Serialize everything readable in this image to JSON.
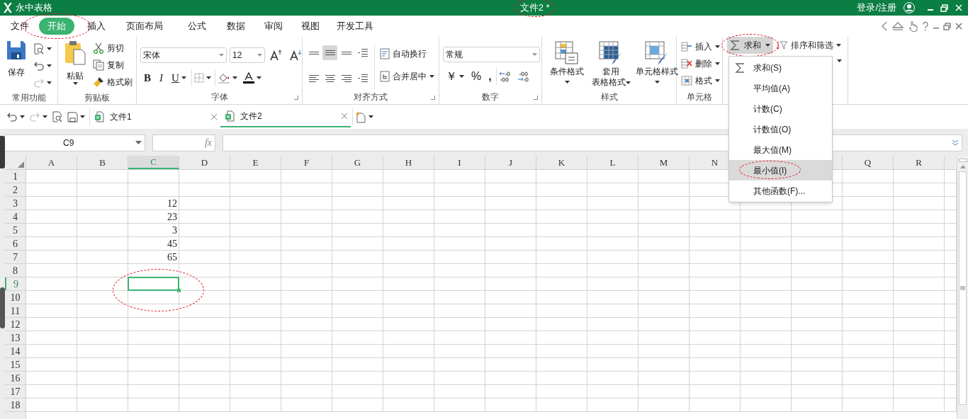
{
  "title_bar": {
    "app_name": "永中表格",
    "document_title": "文件2 *",
    "document_title_circled": true,
    "account": "登录/注册"
  },
  "menu_tabs": [
    {
      "label": "文件",
      "selected": false,
      "circled": false
    },
    {
      "label": "开始",
      "selected": true,
      "circled": true
    },
    {
      "label": "插入",
      "selected": false,
      "circled": false
    },
    {
      "label": "页面布局",
      "selected": false,
      "circled": false
    },
    {
      "label": "公式",
      "selected": false,
      "circled": false
    },
    {
      "label": "数据",
      "selected": false,
      "circled": false
    },
    {
      "label": "审阅",
      "selected": false,
      "circled": false
    },
    {
      "label": "视图",
      "selected": false,
      "circled": false
    },
    {
      "label": "开发工具",
      "selected": false,
      "circled": false
    }
  ],
  "ribbon_groups": [
    {
      "label": "常用功能",
      "items": [
        {
          "label": "保存"
        }
      ]
    },
    {
      "label": "剪贴板",
      "items": [
        {
          "label": "粘贴"
        },
        {
          "label": "剪切"
        },
        {
          "label": "复制"
        },
        {
          "label": "格式刷"
        }
      ]
    },
    {
      "label": "字体",
      "font_name": "宋体",
      "font_size": "12",
      "buttons": [
        {
          "label": "B"
        },
        {
          "label": "I"
        },
        {
          "label": "U"
        }
      ]
    },
    {
      "label": "对齐方式",
      "items": [
        {
          "label": "自动换行"
        },
        {
          "label": "合并居中"
        }
      ]
    },
    {
      "label": "数字",
      "number_format": "常规",
      "buttons": [
        {
          "label": "￥"
        },
        {
          "label": "%"
        },
        {
          "label": ","
        }
      ]
    },
    {
      "label": "样式",
      "items": [
        {
          "lines": [
            "条件格式"
          ]
        },
        {
          "lines": [
            "套用",
            "表格格式"
          ]
        },
        {
          "lines": [
            "单元格样式"
          ]
        }
      ]
    },
    {
      "label": "单元格",
      "items": [
        {
          "label": "插入"
        },
        {
          "label": "删除"
        },
        {
          "label": "格式"
        }
      ]
    }
  ],
  "editing": {
    "sum": {
      "label": "求和",
      "circled": true,
      "expanded": true
    },
    "sort": {
      "label": "排序和筛选"
    }
  },
  "sum_menu": [
    {
      "label": "求和(S)",
      "selected": false,
      "circled": false
    },
    {
      "label": "平均值(A)",
      "selected": false,
      "circled": false
    },
    {
      "label": "计数(C)",
      "selected": false,
      "circled": false
    },
    {
      "label": "计数值(O)",
      "selected": false,
      "circled": false
    },
    {
      "label": "最大值(M)",
      "selected": false,
      "circled": false
    },
    {
      "label": "最小值(I)",
      "selected": true,
      "circled": true
    },
    {
      "label": "其他函数(F)...",
      "selected": false,
      "circled": false
    }
  ],
  "document_tabs": [
    {
      "label": "文件1",
      "selected": false
    },
    {
      "label": "文件2",
      "selected": true
    }
  ],
  "formula_bar": {
    "name_box": "C9",
    "fx": "fx"
  },
  "sheet": {
    "active_cell_circled": true,
    "columns": [
      {
        "label": "A",
        "selected": false
      },
      {
        "label": "B",
        "selected": false
      },
      {
        "label": "C",
        "selected": true
      },
      {
        "label": "D",
        "selected": false
      },
      {
        "label": "E",
        "selected": false
      },
      {
        "label": "F",
        "selected": false
      },
      {
        "label": "G",
        "selected": false
      },
      {
        "label": "H",
        "selected": false
      },
      {
        "label": "I",
        "selected": false
      },
      {
        "label": "J",
        "selected": false
      },
      {
        "label": "K",
        "selected": false
      },
      {
        "label": "L",
        "selected": false
      },
      {
        "label": "M",
        "selected": false
      },
      {
        "label": "N",
        "selected": false
      }
    ],
    "columns_right": [
      {
        "label": "Q",
        "selected": false
      },
      {
        "label": "R",
        "selected": false
      }
    ],
    "rows": [
      {
        "label": "1",
        "selected": false
      },
      {
        "label": "2",
        "selected": false
      },
      {
        "label": "3",
        "selected": false,
        "cells": {
          "C": "12"
        }
      },
      {
        "label": "4",
        "selected": false,
        "cells": {
          "C": "23"
        }
      },
      {
        "label": "5",
        "selected": false,
        "cells": {
          "C": "3"
        }
      },
      {
        "label": "6",
        "selected": false,
        "cells": {
          "C": "45"
        }
      },
      {
        "label": "7",
        "selected": false,
        "cells": {
          "C": "65"
        }
      },
      {
        "label": "8",
        "selected": false
      },
      {
        "label": "9",
        "selected": true
      },
      {
        "label": "10",
        "selected": false
      },
      {
        "label": "11",
        "selected": false
      },
      {
        "label": "12",
        "selected": false
      },
      {
        "label": "13",
        "selected": false
      },
      {
        "label": "14",
        "selected": false
      },
      {
        "label": "15",
        "selected": false
      },
      {
        "label": "16",
        "selected": false
      },
      {
        "label": "17",
        "selected": false
      },
      {
        "label": "18",
        "selected": false
      }
    ]
  }
}
